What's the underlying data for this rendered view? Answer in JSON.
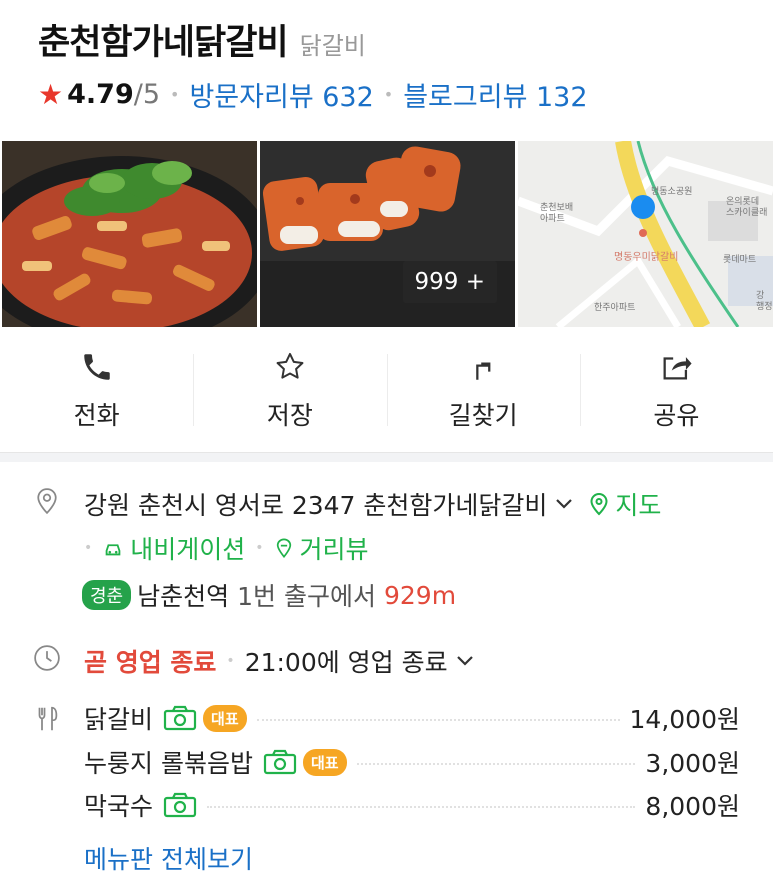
{
  "place": {
    "name": "춘천함가네닭갈비",
    "category": "닭갈비",
    "rating": "4.79",
    "rating_max": "/5",
    "visitor_reviews": "방문자리뷰 632",
    "blog_reviews": "블로그리뷰 132"
  },
  "photos": {
    "count_badge": "999 +",
    "map_pin_label": "명동우미닭갈비",
    "map_labels": [
      "춘천보배\n아파트",
      "명동소공원",
      "온의롯데\n스카이클래",
      "롯데마트",
      "한주아파트",
      "강\n행정복"
    ]
  },
  "actions": [
    {
      "label": "전화",
      "icon": "phone-icon"
    },
    {
      "label": "저장",
      "icon": "star-icon"
    },
    {
      "label": "길찾기",
      "icon": "directions-icon"
    },
    {
      "label": "공유",
      "icon": "share-icon"
    }
  ],
  "address": {
    "text": "강원 춘천시 영서로 2347 춘천함가네닭갈비",
    "map_link": "지도",
    "navigation_link": "내비게이션",
    "street_view_link": "거리뷰"
  },
  "subway": {
    "line": "경춘",
    "station": "남춘천역",
    "exit_text": "1번 출구에서",
    "distance": "929m"
  },
  "hours": {
    "status": "곧 영업 종료",
    "detail": "21:00에 영업 종료"
  },
  "menu": {
    "items": [
      {
        "name": "닭갈비",
        "badge": "대표",
        "price": "14,000원"
      },
      {
        "name": "누룽지 롤볶음밥",
        "badge": "대표",
        "price": "3,000원"
      },
      {
        "name": "막국수",
        "badge": "",
        "price": "8,000원"
      }
    ],
    "view_all": "메뉴판 전체보기"
  },
  "colors": {
    "accent_blue": "#1a70c7",
    "green": "#20b24a",
    "red": "#e24a3b",
    "badge_orange": "#f6a623",
    "star": "#e8372c"
  }
}
